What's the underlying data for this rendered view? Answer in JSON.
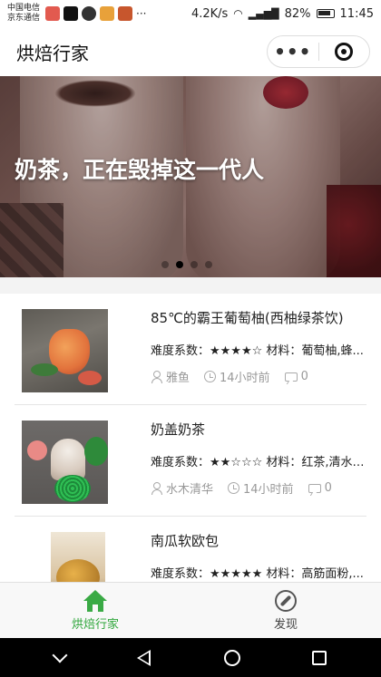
{
  "status_bar": {
    "carrier_1": "中国电信",
    "carrier_2": "京东通信",
    "more": "···",
    "speed": "4.2K/s",
    "battery": "82%",
    "time": "11:45"
  },
  "nav": {
    "title": "烘焙行家",
    "more_label": "•••"
  },
  "banner": {
    "title": "奶茶，正在毁掉这一代人",
    "indicator_count": 4,
    "active_index": 1
  },
  "articles": [
    {
      "title": "85℃的霸王葡萄柚(西柚绿茶饮)",
      "meta": "难度系数：★★★★☆ 材料：葡萄柚,蜂...",
      "author": "雅鱼",
      "time": "14小时前",
      "comments": "0"
    },
    {
      "title": "奶盖奶茶",
      "meta": "难度系数：★★☆☆☆ 材料：红茶,清水,...",
      "author": "水木清华",
      "time": "14小时前",
      "comments": "0"
    },
    {
      "title": "南瓜软欧包",
      "meta": "难度系数：★★★★★ 材料：高筋面粉,...",
      "author": "",
      "time": "",
      "comments": ""
    }
  ],
  "tabbar": {
    "tabs": [
      {
        "label": "烘焙行家",
        "icon": "home-icon",
        "active": true
      },
      {
        "label": "发现",
        "icon": "compass-icon",
        "active": false
      }
    ],
    "active_color": "#2fa63b"
  }
}
